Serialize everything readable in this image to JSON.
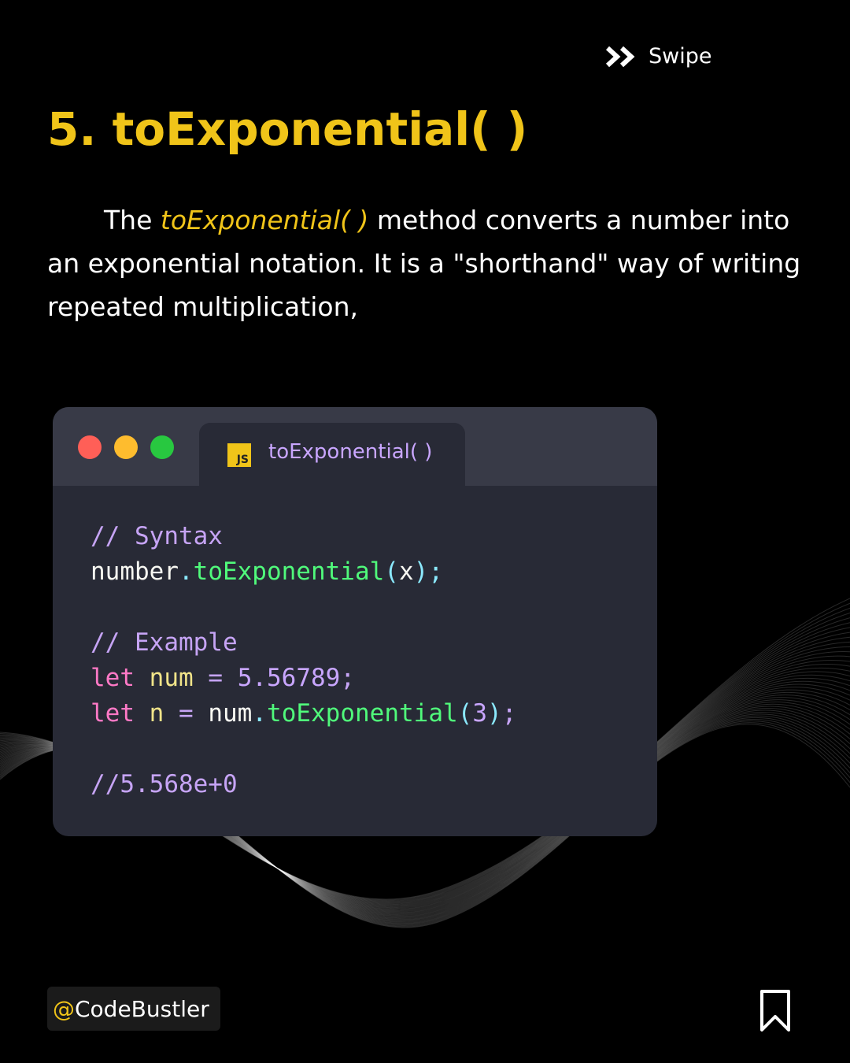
{
  "colors": {
    "accent": "#f0c419",
    "background": "#000000",
    "editor_bg": "#282a36",
    "editor_bar": "#383a47"
  },
  "header": {
    "swipe_icon": "double-chevron-right-icon",
    "swipe_label": "Swipe"
  },
  "slide": {
    "heading": "5. toExponential( )",
    "intro": {
      "before": "The ",
      "highlight": "toExponential( )",
      "after": " method converts a number into an exponential notation. It is a \"shorthand\" way of writing repeated multiplication,"
    }
  },
  "editor": {
    "window_buttons": [
      "close",
      "minimize",
      "maximize"
    ],
    "tab": {
      "icon": "JS",
      "label": "toExponential( )"
    },
    "code": {
      "syntax_comment": "// Syntax",
      "syntax_object": "number",
      "dot": ".",
      "syntax_method": "toExponential",
      "open_paren": "(",
      "syntax_arg": "x",
      "close_paren": ")",
      "semicolon": ";",
      "example_comment": "// Example",
      "keyword": "let",
      "var1": "num",
      "equals": "=",
      "num_value": "5.56789",
      "var2": "n",
      "call_object": "num",
      "call_method": "toExponential",
      "call_arg": "3",
      "result_comment": "//5.568e+0"
    }
  },
  "footer": {
    "handle_at": "@",
    "handle_name": "CodeBustler",
    "bookmark_icon": "bookmark-icon"
  }
}
